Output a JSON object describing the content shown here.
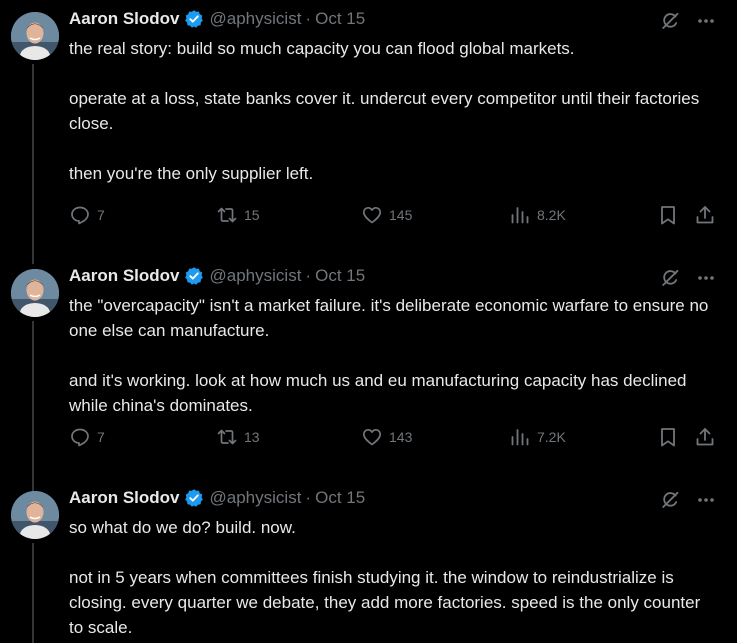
{
  "colors": {
    "background": "#000000",
    "text": "#e7e9ea",
    "muted": "#71767b",
    "verified": "#1d9bf0",
    "thread_line": "#333639"
  },
  "tweets": [
    {
      "name": "Aaron Slodov",
      "handle": "@aphysicist",
      "dot": "·",
      "date": "Oct 15",
      "paragraphs": [
        "the real story: build so much capacity you can flood global markets.",
        "operate at a loss, state banks cover it. undercut every competitor until their factories close.",
        "then you're the only supplier left."
      ],
      "replies": "7",
      "retweets": "15",
      "likes": "145",
      "views": "8.2K"
    },
    {
      "name": "Aaron Slodov",
      "handle": "@aphysicist",
      "dot": "·",
      "date": "Oct 15",
      "paragraphs": [
        "the \"overcapacity\" isn't a market failure. it's deliberate economic warfare to ensure no one else can manufacture.",
        "and it's working. look at how much us and eu manufacturing capacity has declined while china's dominates."
      ],
      "replies": "7",
      "retweets": "13",
      "likes": "143",
      "views": "7.2K"
    },
    {
      "name": "Aaron Slodov",
      "handle": "@aphysicist",
      "dot": "·",
      "date": "Oct 15",
      "paragraphs": [
        "so what do we do? build. now.",
        "not in 5 years when committees finish studying it. the window to reindustrialize is closing. every quarter we debate, they add more factories. speed is the only counter to scale."
      ]
    }
  ]
}
